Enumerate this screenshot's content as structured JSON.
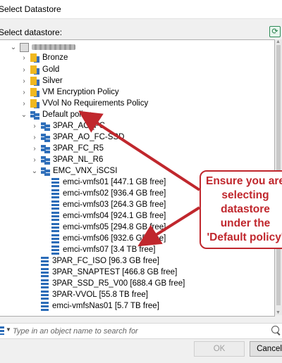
{
  "dialog": {
    "title": "Select Datastore",
    "select_label": "Select datastore:"
  },
  "tree": {
    "vcenter": {
      "label": ""
    },
    "policies": [
      {
        "label": "Bronze"
      },
      {
        "label": "Gold"
      },
      {
        "label": "Silver"
      },
      {
        "label": "VM Encryption Policy"
      },
      {
        "label": "VVol No Requirements Policy"
      }
    ],
    "default_policy": {
      "label": "Default policy"
    },
    "clusters": [
      {
        "label": "3PAR_AO_FC"
      },
      {
        "label": "3PAR_AO_FC-SSD"
      },
      {
        "label": "3PAR_FC_R5"
      },
      {
        "label": "3PAR_NL_R6"
      }
    ],
    "emc_cluster": {
      "label": "EMC_VNX_iSCSI"
    },
    "emc_datastores": [
      {
        "label": "emci-vmfs01 [447.1 GB free]"
      },
      {
        "label": "emci-vmfs02 [936.4 GB free]"
      },
      {
        "label": "emci-vmfs03 [264.3 GB free]"
      },
      {
        "label": "emci-vmfs04 [924.1 GB free]"
      },
      {
        "label": "emci-vmfs05 [294.8 GB free]"
      },
      {
        "label": "emci-vmfs06 [932.6 GB free]"
      },
      {
        "label": "emci-vmfs07 [3.4 TB free]"
      }
    ],
    "other_datastores": [
      {
        "label": "3PAR_FC_ISO [96.3 GB free]"
      },
      {
        "label": "3PAR_SNAPTEST [466.8 GB free]"
      },
      {
        "label": "3PAR_SSD_R5_V00 [688.4 GB free]"
      },
      {
        "label": "3PAR-VVOL [55.8 TB free]"
      },
      {
        "label": "emci-vmfsNas01 [5.7 TB free]"
      }
    ]
  },
  "search": {
    "placeholder": "Type in an object name to search for"
  },
  "buttons": {
    "ok": "OK",
    "cancel": "Cancel"
  },
  "annotation": {
    "lines": [
      "Ensure you are",
      "selecting",
      "datastore",
      "under the",
      "'Default policy'"
    ],
    "color": "#c0272d"
  }
}
